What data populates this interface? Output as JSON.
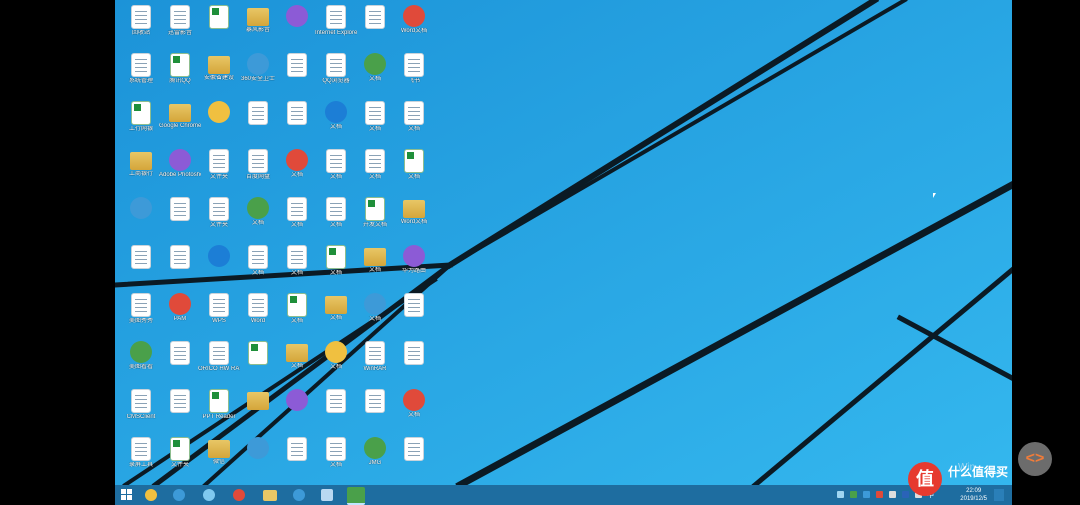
{
  "desktop": {
    "columns": [
      [
        "回收站",
        "迅雷影音",
        "",
        "暴风影音",
        "",
        "Internet Explorer",
        "",
        "Word文档"
      ],
      [
        "系统管理",
        "腾讯QQ",
        "安徽省建设",
        "360安全卫士",
        "",
        "QQ浏览器",
        "文档",
        "飞书"
      ],
      [
        "工行网银",
        "Google Chrome",
        "",
        "",
        "",
        "文档",
        "文档",
        "文档"
      ],
      [
        "工商银行",
        "Adobe Photoshop",
        "文件夹",
        "百度网盘",
        "文档",
        "文档",
        "文档",
        "文档"
      ],
      [
        "",
        "",
        "文件夹",
        "文档",
        "文档",
        "文档",
        "开发文档",
        "Word文档"
      ],
      [
        "",
        "",
        "",
        "文档",
        "文档",
        "文档",
        "文档",
        "华为路由"
      ],
      [
        "美图秀秀",
        "PAM",
        "WPS",
        "Word",
        "文档",
        "文档",
        "文档",
        ""
      ],
      [
        "美图看看",
        "",
        "ORICO HW RAID",
        "",
        "文档",
        "文档",
        "WinRAR",
        ""
      ],
      [
        "CMSClient",
        "",
        "PPT Reader",
        "",
        "",
        "",
        "",
        "文档"
      ],
      [
        "录屏工具",
        "文件夹",
        "微信",
        "",
        "",
        "文档",
        "JMG",
        ""
      ]
    ]
  },
  "taskbar": {
    "time": "22:09",
    "date": "2019/12/5",
    "ime": "中",
    "items": [
      "file-explorer-icon",
      "app-icon",
      "ie-icon",
      "chrome-icon",
      "folder-icon",
      "browser-icon",
      "feishu-icon",
      "wechat-icon"
    ]
  },
  "watermark": {
    "windows_text": "Win",
    "site_logo": "值",
    "site_name": "什么值得买",
    "site_sub": ""
  },
  "colors": {
    "wallpaper": "#27a8e6",
    "taskbar": "#1e6da0",
    "stripe": "#0b1a24"
  }
}
